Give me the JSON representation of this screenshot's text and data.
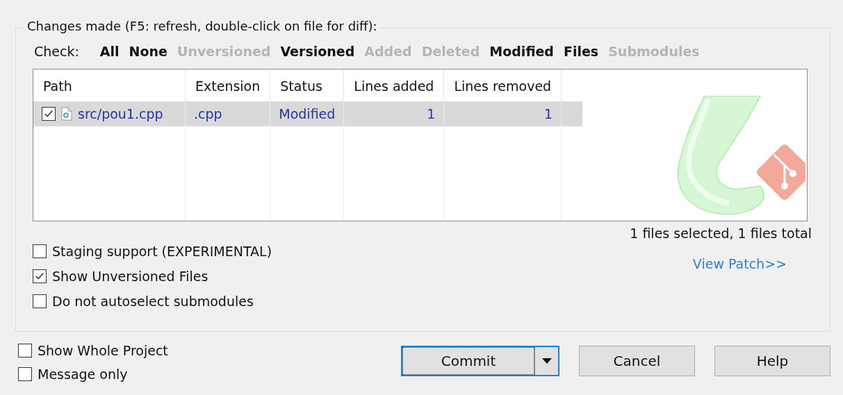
{
  "group_title": "Changes made (F5: refresh, double-click on file for diff):",
  "check_label": "Check:",
  "check_filters": [
    {
      "label": "All",
      "disabled": false
    },
    {
      "label": "None",
      "disabled": false
    },
    {
      "label": "Unversioned",
      "disabled": true
    },
    {
      "label": "Versioned",
      "disabled": false
    },
    {
      "label": "Added",
      "disabled": true
    },
    {
      "label": "Deleted",
      "disabled": true
    },
    {
      "label": "Modified",
      "disabled": false
    },
    {
      "label": "Files",
      "disabled": false
    },
    {
      "label": "Submodules",
      "disabled": true
    }
  ],
  "table": {
    "columns": [
      "Path",
      "Extension",
      "Status",
      "Lines added",
      "Lines removed"
    ],
    "rows": [
      {
        "checked": true,
        "selected": true,
        "path": "src/pou1.cpp",
        "extension": ".cpp",
        "status": "Modified",
        "lines_added": "1",
        "lines_removed": "1"
      }
    ]
  },
  "selection_summary": "1 files selected, 1 files total",
  "view_patch_link": "View Patch>>",
  "options": [
    {
      "label": "Staging support (EXPERIMENTAL)",
      "checked": false
    },
    {
      "label": "Show Unversioned Files",
      "checked": true
    },
    {
      "label": "Do not autoselect submodules",
      "checked": false
    }
  ],
  "bottom_options": [
    {
      "label": "Show Whole Project",
      "checked": false
    },
    {
      "label": "Message only",
      "checked": false
    }
  ],
  "buttons": {
    "commit": "Commit",
    "cancel": "Cancel",
    "help": "Help"
  }
}
